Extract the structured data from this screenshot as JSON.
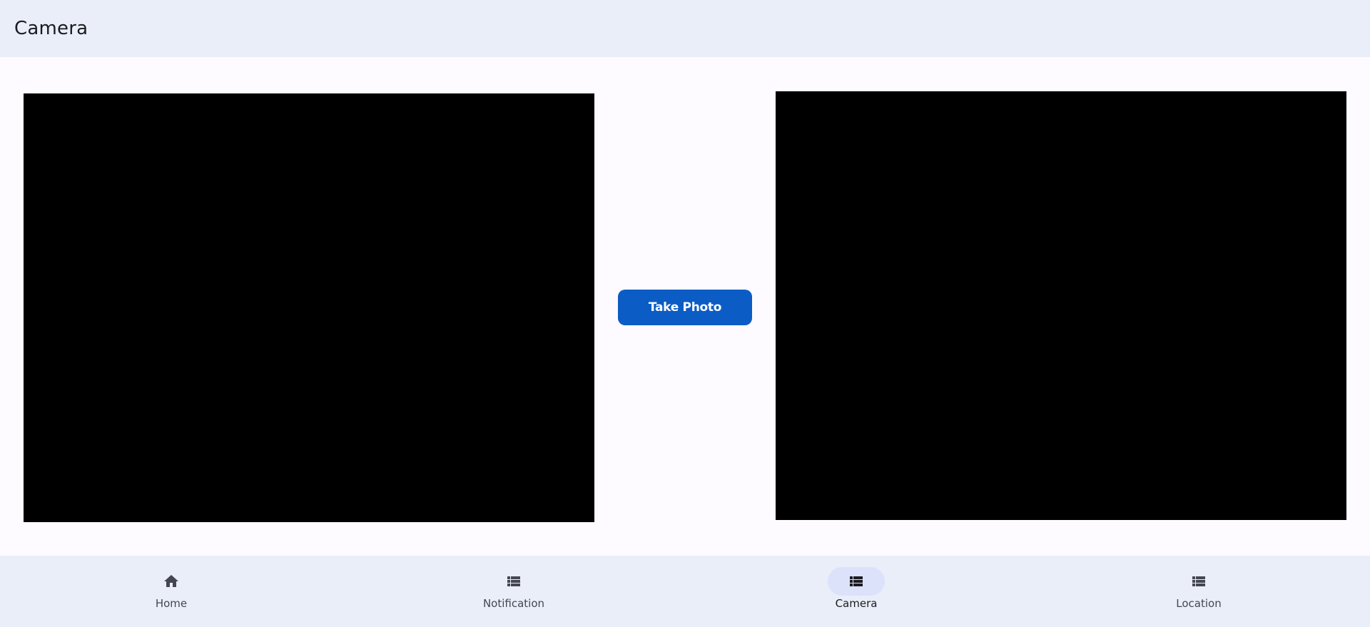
{
  "app_bar": {
    "title": "Camera"
  },
  "main": {
    "take_photo_label": "Take Photo"
  },
  "bottom_nav": {
    "items": [
      {
        "label": "Home",
        "icon": "home-icon",
        "active": false
      },
      {
        "label": "Notification",
        "icon": "list-icon",
        "active": false
      },
      {
        "label": "Camera",
        "icon": "list-icon",
        "active": true
      },
      {
        "label": "Location",
        "icon": "list-icon",
        "active": false
      }
    ]
  },
  "colors": {
    "app_bar_bg": "#e9eef9",
    "background": "#fdfbff",
    "preview": "#000000",
    "primary_button": "#0b5cc5",
    "nav_active_indicator": "#dce2fa"
  }
}
